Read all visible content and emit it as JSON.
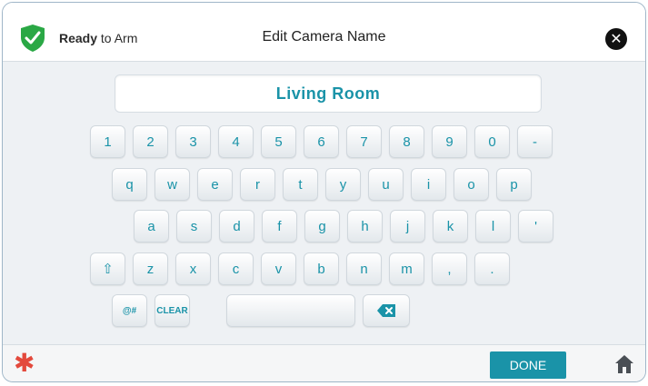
{
  "header": {
    "status_bold": "Ready",
    "status_rest": " to Arm",
    "title": "Edit Camera Name",
    "close_glyph": "✕",
    "status_icon": "shield-check-icon",
    "accent": "#1a93a8",
    "status_color": "#2aa845"
  },
  "input": {
    "value": "Living Room"
  },
  "keyboard": {
    "row1": [
      "1",
      "2",
      "3",
      "4",
      "5",
      "6",
      "7",
      "8",
      "9",
      "0",
      "-"
    ],
    "row2": [
      "q",
      "w",
      "e",
      "r",
      "t",
      "y",
      "u",
      "i",
      "o",
      "p"
    ],
    "row3": [
      "a",
      "s",
      "d",
      "f",
      "g",
      "h",
      "j",
      "k",
      "l",
      "'"
    ],
    "row4": [
      "⇧",
      "z",
      "x",
      "c",
      "v",
      "b",
      "n",
      "m",
      ",",
      "."
    ],
    "symbols_label": "@#",
    "clear_label": "CLEAR",
    "backspace_glyph": "✕"
  },
  "footer": {
    "done_label": "DONE",
    "alert_glyph": "✱",
    "home_icon": "home-icon"
  }
}
